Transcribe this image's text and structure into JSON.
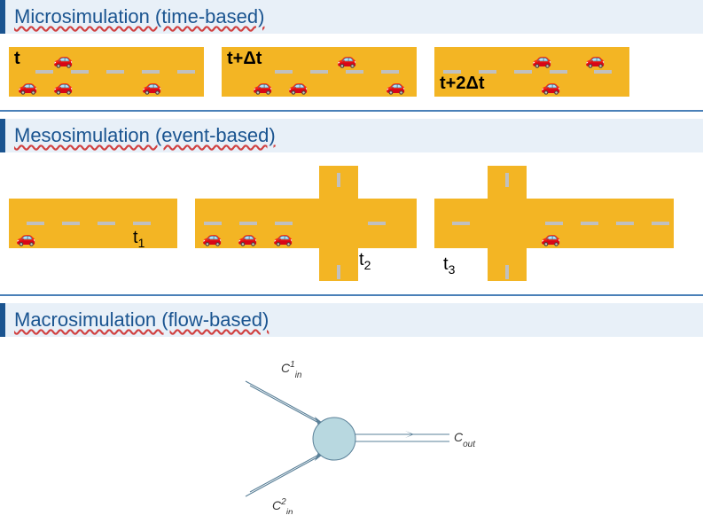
{
  "sections": {
    "micro": {
      "title": "Microsimulation (time-based)"
    },
    "meso": {
      "title": "Mesosimulation (event-based)"
    },
    "macro": {
      "title": "Macrosimulation (flow-based)"
    }
  },
  "micro_labels": {
    "t0": "t",
    "t1": "t+Δt",
    "t2": "t+2Δt"
  },
  "meso_labels": {
    "t1": "t",
    "t1sub": "1",
    "t2": "t",
    "t2sub": "2",
    "t3": "t",
    "t3sub": "3"
  },
  "macro_labels": {
    "cin1": "C",
    "cin1sup": "1",
    "cin1sub": "in",
    "cin2": "C",
    "cin2sup": "2",
    "cin2sub": "in",
    "cout": "C",
    "coutsub": "out"
  }
}
